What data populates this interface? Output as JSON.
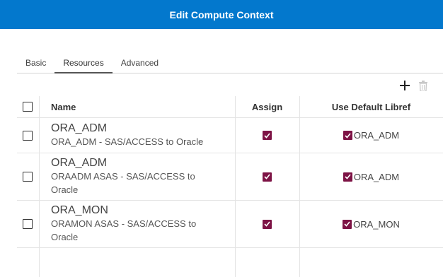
{
  "dialog": {
    "title": "Edit Compute Context"
  },
  "tabs": [
    {
      "label": "Basic",
      "active": false
    },
    {
      "label": "Resources",
      "active": true
    },
    {
      "label": "Advanced",
      "active": false
    }
  ],
  "toolbar": {
    "add_icon": "plus-icon",
    "delete_icon": "trash-icon"
  },
  "table": {
    "columns": [
      "Name",
      "Assign",
      "Use Default Libref"
    ],
    "rows": [
      {
        "selected": false,
        "name": "ORA_ADM",
        "description": "ORA_ADM - SAS/ACCESS to Oracle",
        "assign": true,
        "use_default": true,
        "libref": "ORA_ADM"
      },
      {
        "selected": false,
        "name": "ORA_ADM",
        "description": "ORAADM ASAS - SAS/ACCESS to Oracle",
        "assign": true,
        "use_default": true,
        "libref": "ORA_ADM"
      },
      {
        "selected": false,
        "name": "ORA_MON",
        "description": "ORAMON ASAS - SAS/ACCESS to Oracle",
        "assign": true,
        "use_default": true,
        "libref": "ORA_MON"
      }
    ]
  },
  "colors": {
    "header": "#0378cd",
    "checkbox_checked": "#7d1345"
  }
}
